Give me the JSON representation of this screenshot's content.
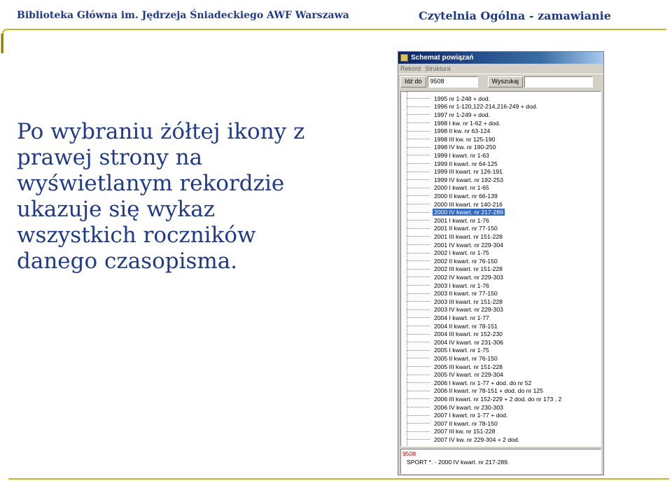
{
  "header": {
    "left_title": "Biblioteka Główna im. Jędrzeja Śniadeckiego AWF Warszawa",
    "right_title": "Czytelnia Ogólna - zamawianie"
  },
  "description": "Po wybraniu żółtej ikony z prawej strony na wyświetlanym rekordzie ukazuje się wykaz wszystkich roczników danego czasopisma.",
  "window": {
    "title": "Schemat powiązań",
    "menu": [
      "Rekord",
      "Struktura"
    ],
    "toolbar": {
      "goto_label": "Idź do",
      "goto_value": "9508",
      "search_label": "Wyszukaj",
      "search_value": ""
    },
    "tree_items": [
      "1995  nr 1-248 + dod.",
      "1996  nr 1-120,122-214,216-249 + dod.",
      "1997  nr 1-249 + dod.",
      "1998  I kw.  nr 1-62 + dod.",
      "1998  II kw.  nr 63-124",
      "1998  III  kw.  nr 125-190",
      "1998  IV kw.  nr 190-250",
      "1999  I kwart.  nr 1-63",
      "1999  II kwart.  nr 64-125",
      "1999  III kwart.  nr 126-191",
      "1999  IV kwart.  nr 192-253",
      "2000  I kwart.  nr 1-65",
      "2000  II kwart.  nr 66-139",
      "2000  III kwart.  nr 140-216",
      "2000  IV kwart.  nr 217-289",
      "2001  I kwart.  nr 1-76",
      "2001  II kwart.  nr 77-150",
      "2001  III kwart.  nr 151-228",
      "2001  IV kwart.  nr 229-304",
      "2002  I kwart.  nr 1-75",
      "2002  II kwart.  nr 76-150",
      "2002  III kwart.  nr 151-228",
      "2002  IV kwart.  nr 229-303",
      "2003  I kwart.  nr 1-76",
      "2003  II kwart.  nr 77-150",
      "2003  III kwart.  nr 151-228",
      "2003  IV kwart.  nr 229-303",
      "2004  I kwart.  nr 1-77",
      "2004  II kwart.  nr 78-151",
      "2004  III kwart.  nr 152-230",
      "2004  IV kwart.  nr 231-306",
      "2005  I kwart.  nr 1-75",
      "2005  II kwart.  nr 76-150",
      "2005  III kwart.  nr 151-228",
      "2005  IV kwart.  nr 229-304",
      "2006  I kwart.  nr 1-77 + dod. do nr 52",
      "2006  II kwart.  nr 78-151 + dod. do nr 125",
      "2006  III kwart.  nr 152-229 + 2 dod. do nr 173 , 2",
      "2006  IV kwart.  nr 230-303",
      "2007  I kwart.  nr 1-77 + dod.",
      "2007  II kwart.  nr 78-150",
      "2007  III kw.  nr 151-228",
      "2007  IV kw.  nr 229-304 + 2 dod."
    ],
    "selected_item": "2000  IV kwart.  nr 217-289",
    "status": {
      "id": "9508",
      "record": "SPORT *. - 2000  IV kwart.  nr 217-289."
    }
  },
  "colors": {
    "header_text": "#1e3a8a",
    "accent_line": "#c9b81d",
    "selection": "#316ac5"
  }
}
